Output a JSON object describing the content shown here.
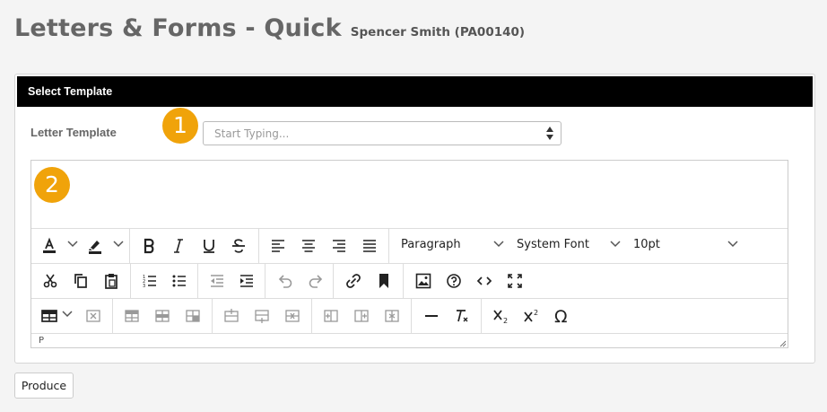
{
  "page": {
    "title": "Letters & Forms - Quick",
    "patient": "Spencer Smith (PA00140)"
  },
  "panel": {
    "header": "Select Template",
    "template_label": "Letter Template",
    "template_placeholder": "Start Typing..."
  },
  "badges": {
    "one": "1",
    "two": "2"
  },
  "editor": {
    "block_format": "Paragraph",
    "font_family": "System Font",
    "font_size": "10pt",
    "status_path": "P",
    "icons": [
      "text-color-icon",
      "highlight-color-icon",
      "bold-icon",
      "italic-icon",
      "underline-icon",
      "strikethrough-icon",
      "align-left-icon",
      "align-center-icon",
      "align-right-icon",
      "align-justify-icon",
      "cut-icon",
      "copy-icon",
      "paste-icon",
      "numbered-list-icon",
      "bullet-list-icon",
      "outdent-icon",
      "indent-icon",
      "undo-icon",
      "redo-icon",
      "link-icon",
      "bookmark-icon",
      "image-icon",
      "help-icon",
      "source-code-icon",
      "fullscreen-icon",
      "table-icon",
      "delete-table-icon",
      "row-props-icon",
      "insert-row-before-icon",
      "insert-row-after-icon",
      "delete-row-icon",
      "insert-col-before-icon",
      "insert-col-after-icon",
      "delete-col-icon",
      "horizontal-line-icon",
      "clear-format-icon",
      "subscript-icon",
      "superscript-icon",
      "special-char-icon"
    ]
  },
  "actions": {
    "produce": "Produce"
  },
  "colors": {
    "header_bg": "#000000",
    "badge": "#f0a30a",
    "page_bg": "#f4f4f4"
  }
}
